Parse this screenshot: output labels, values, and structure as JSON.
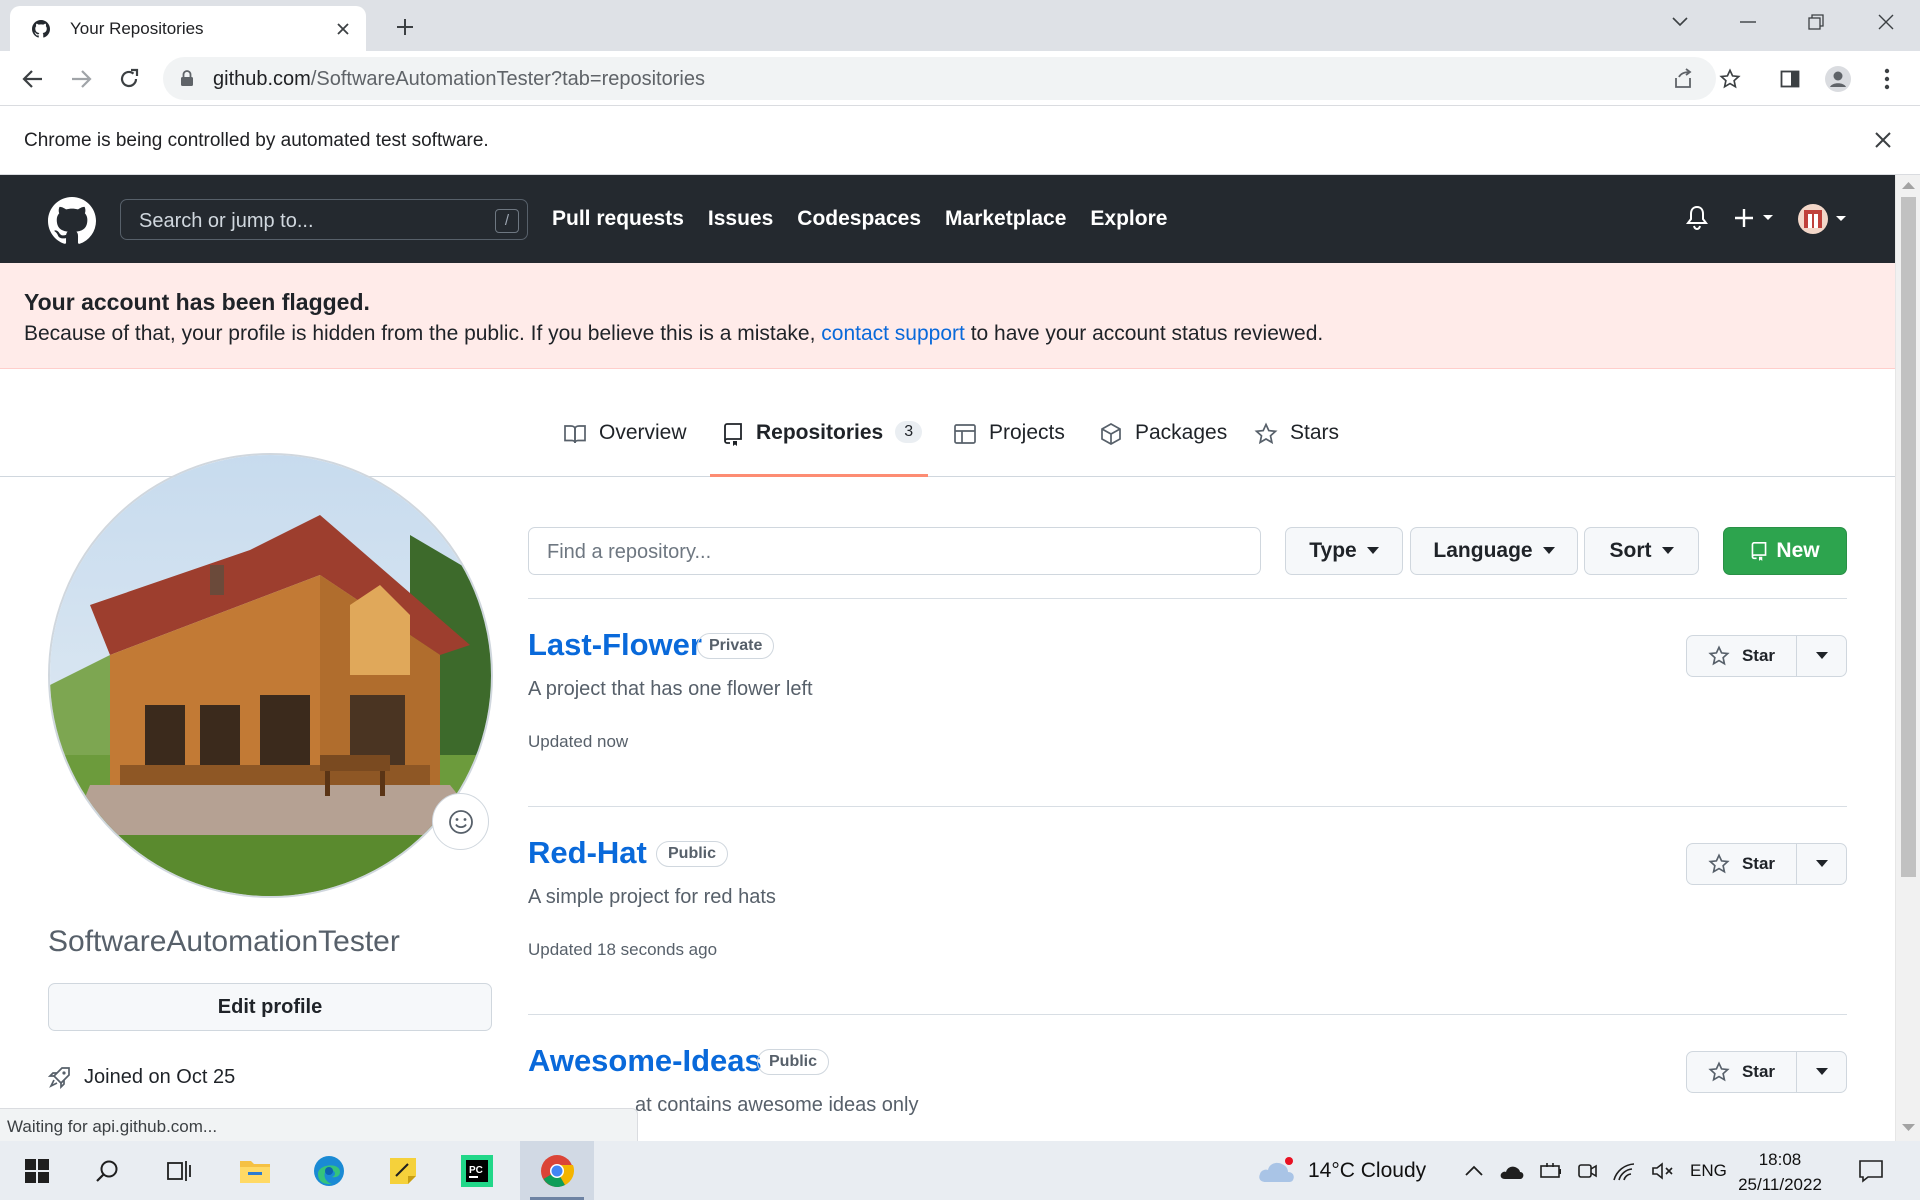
{
  "browser": {
    "tab_title": "Your Repositories",
    "url_host": "github.com",
    "url_path": "/SoftwareAutomationTester?tab=repositories",
    "infobar_message": "Chrome is being controlled by automated test software.",
    "status_text": "Waiting for api.github.com..."
  },
  "header": {
    "search_placeholder": "Search or jump to...",
    "search_shortcut": "/",
    "nav": [
      "Pull requests",
      "Issues",
      "Codespaces",
      "Marketplace",
      "Explore"
    ]
  },
  "flash": {
    "title": "Your account has been flagged.",
    "body_before": "Because of that, your profile is hidden from the public. If you believe this is a mistake,",
    "link": "contact support",
    "body_after": "to have your account status reviewed."
  },
  "profile_tabs": [
    {
      "label": "Overview",
      "icon": "book-icon"
    },
    {
      "label": "Repositories",
      "icon": "repo-icon",
      "count": "3",
      "selected": true
    },
    {
      "label": "Projects",
      "icon": "table-icon"
    },
    {
      "label": "Packages",
      "icon": "package-icon"
    },
    {
      "label": "Stars",
      "icon": "star-icon"
    }
  ],
  "profile": {
    "username": "SoftwareAutomationTester",
    "edit_label": "Edit profile",
    "joined": "Joined on Oct 25"
  },
  "filters": {
    "find_placeholder": "Find a repository...",
    "type_label": "Type",
    "language_label": "Language",
    "sort_label": "Sort",
    "new_label": "New"
  },
  "repos": [
    {
      "name": "Last-Flower",
      "visibility": "Private",
      "description": "A project that has one flower left",
      "updated": "Updated now",
      "star_label": "Star"
    },
    {
      "name": "Red-Hat",
      "visibility": "Public",
      "description": "A simple project for red hats",
      "updated": "Updated 18 seconds ago",
      "star_label": "Star"
    },
    {
      "name": "Awesome-Ideas",
      "visibility": "Public",
      "description": "at contains awesome ideas only",
      "updated": "",
      "star_label": "Star"
    }
  ],
  "taskbar": {
    "weather": "14°C  Cloudy",
    "lang": "ENG",
    "time": "18:08",
    "date": "25/11/2022"
  },
  "colors": {
    "header_bg": "#24292f",
    "flash_bg": "#ffebe9",
    "link": "#0969da",
    "new_button": "#2da44e",
    "tab_underline": "#fd8c73"
  }
}
